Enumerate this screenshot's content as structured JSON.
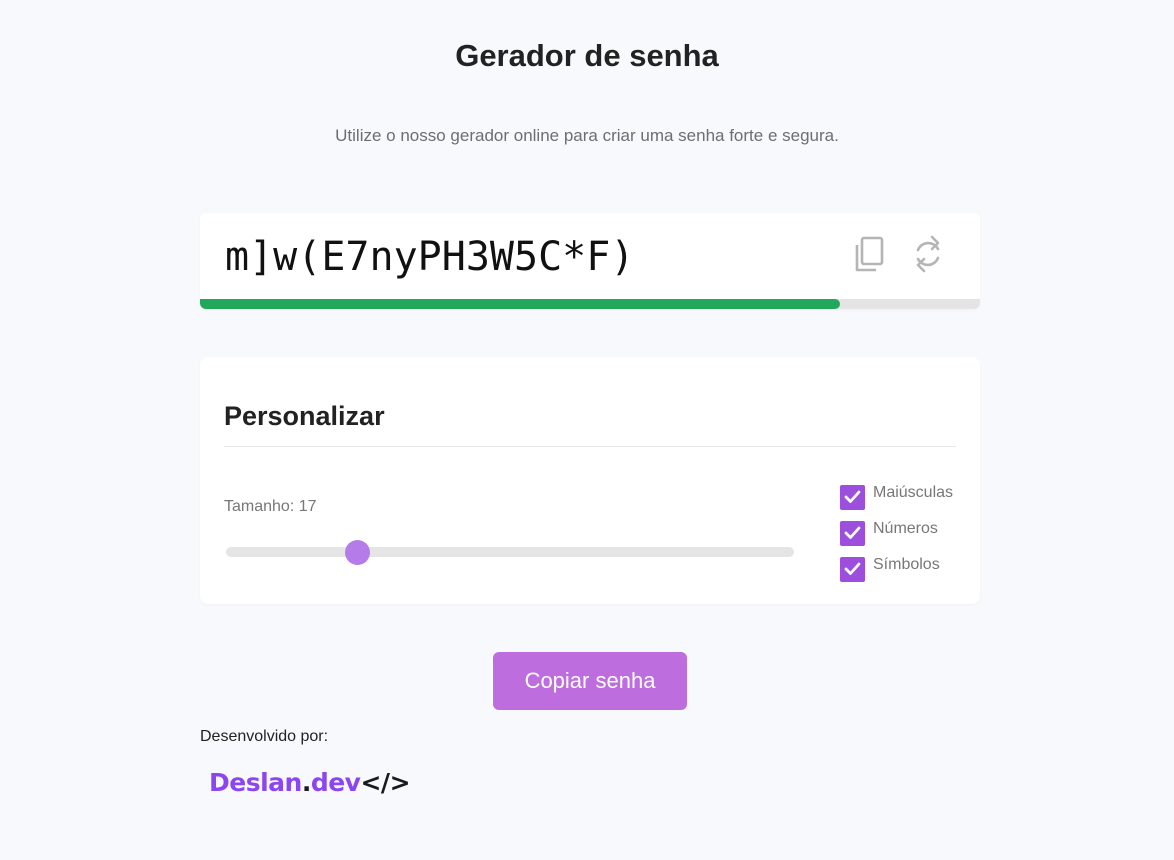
{
  "header": {
    "title": "Gerador de senha",
    "subtitle": "Utilize o nosso gerador online para criar uma senha forte e segura."
  },
  "password": {
    "value": "m]w(E7nyPH3W5C*F)",
    "strength_fraction": 0.82,
    "strength_color": "#22a85a",
    "copy_icon": "copy-icon",
    "refresh_icon": "refresh-icon"
  },
  "customize": {
    "title": "Personalizar",
    "size_label": "Tamanho: 17",
    "slider_fraction": 0.23,
    "options": [
      {
        "label": "Maiúsculas",
        "checked": true
      },
      {
        "label": "Números",
        "checked": true
      },
      {
        "label": "Símbolos",
        "checked": true
      }
    ]
  },
  "actions": {
    "copy_button": "Copiar senha"
  },
  "footer": {
    "developed_by": "Desenvolvido por:",
    "logo_name": "Deslan",
    "logo_dot": ".",
    "logo_dev": "dev",
    "logo_tag": "</>"
  },
  "colors": {
    "accent": "#9b4fdc",
    "button": "#bd6ddd",
    "slider_thumb": "#b57be8",
    "logo": "#8b46f0"
  }
}
